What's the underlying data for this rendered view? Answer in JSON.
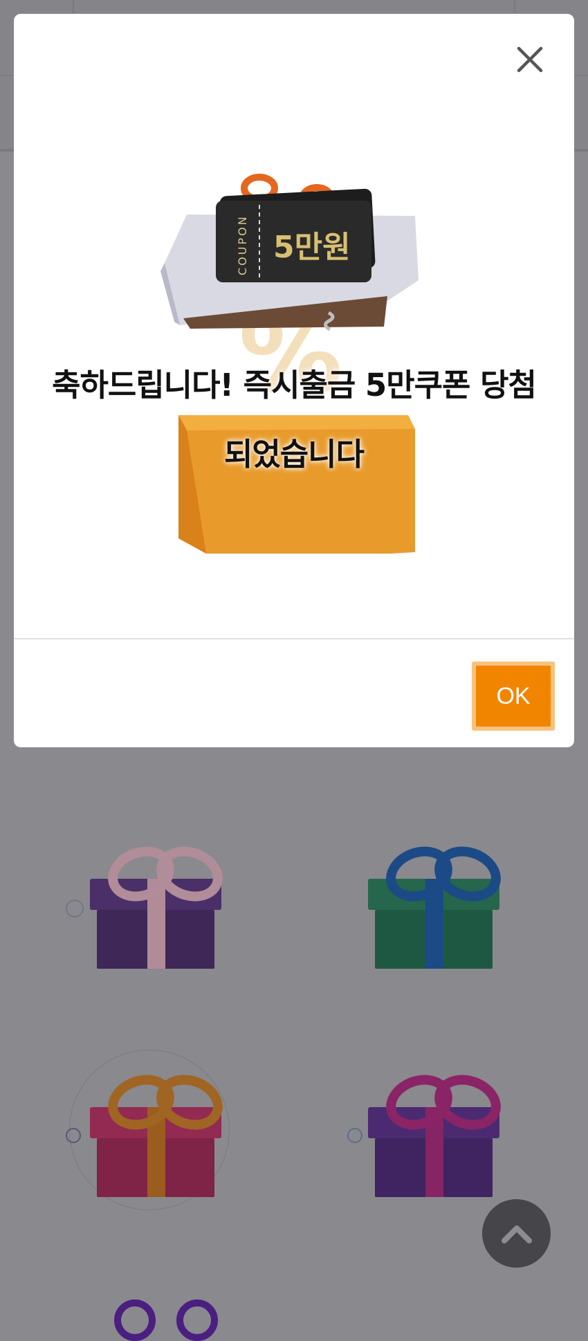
{
  "modal": {
    "message_line1": "축하드립니다! 즉시출금 5만쿠폰 당첨",
    "message_line2": "되었습니다",
    "ok_label": "OK",
    "close_icon": "close-icon"
  },
  "coupon": {
    "side_label": "COUPON",
    "amount": "5만원"
  },
  "colors": {
    "accent": "#f28500",
    "overlay": "#8a898e"
  },
  "gifts": [
    {
      "name": "purple-gift",
      "box": "#4b2f6b",
      "ribbon": "#c79aa9"
    },
    {
      "name": "green-gift",
      "box": "#24684f",
      "ribbon": "#1d4f8e"
    },
    {
      "name": "pink-gift",
      "box": "#9a2a55",
      "ribbon": "#a8641c"
    },
    {
      "name": "violet-gift",
      "box": "#4e2b76",
      "ribbon": "#8c2468"
    }
  ]
}
